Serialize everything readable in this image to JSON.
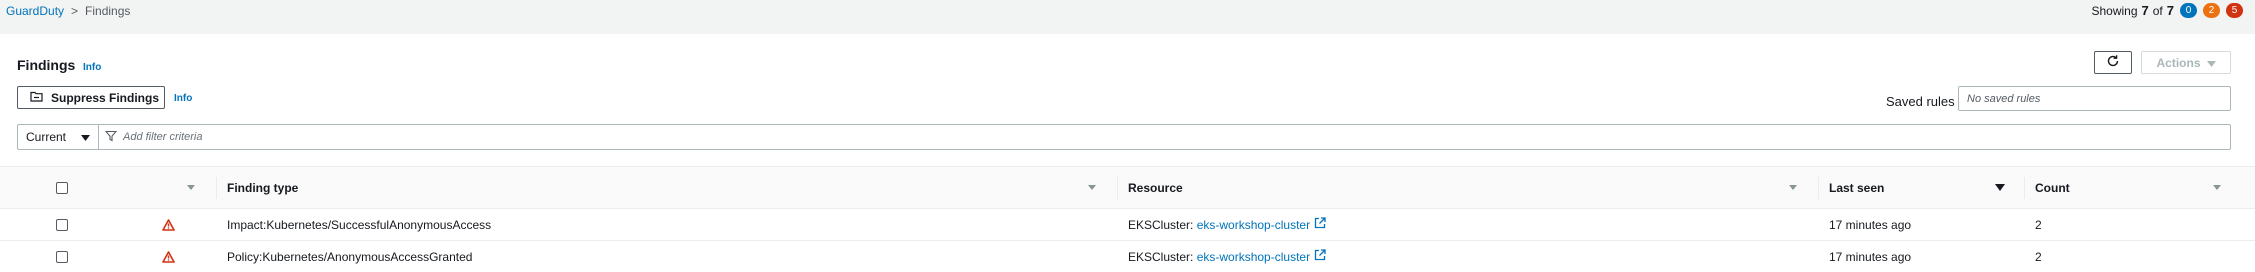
{
  "breadcrumb": {
    "root": "GuardDuty",
    "separator": ">",
    "current": "Findings"
  },
  "summary": {
    "showing_label": "Showing",
    "shown": "7",
    "of_label": "of",
    "total": "7",
    "badges": [
      {
        "value": "0",
        "color": "#0073bb"
      },
      {
        "value": "2",
        "color": "#ec7211"
      },
      {
        "value": "5",
        "color": "#d13212"
      }
    ]
  },
  "header": {
    "title": "Findings",
    "info": "Info"
  },
  "toolbar": {
    "suppress_label": "Suppress Findings",
    "suppress_info": "Info",
    "actions_label": "Actions",
    "saved_rules_label": "Saved rules",
    "saved_rules_placeholder": "No saved rules"
  },
  "filter": {
    "scope": "Current",
    "placeholder": "Add filter criteria"
  },
  "table": {
    "columns": [
      "Finding type",
      "Resource",
      "Last seen",
      "Count"
    ],
    "rows": [
      {
        "finding_type": "Impact:Kubernetes/SuccessfulAnonymousAccess",
        "resource_prefix": "EKSCluster:",
        "resource_link": "eks-workshop-cluster",
        "last_seen": "17 minutes ago",
        "count": "2"
      },
      {
        "finding_type": "Policy:Kubernetes/AnonymousAccessGranted",
        "resource_prefix": "EKSCluster:",
        "resource_link": "eks-workshop-cluster",
        "last_seen": "17 minutes ago",
        "count": "2"
      }
    ]
  },
  "colors": {
    "accent": "#0073bb",
    "severity_high": "#d13212"
  }
}
